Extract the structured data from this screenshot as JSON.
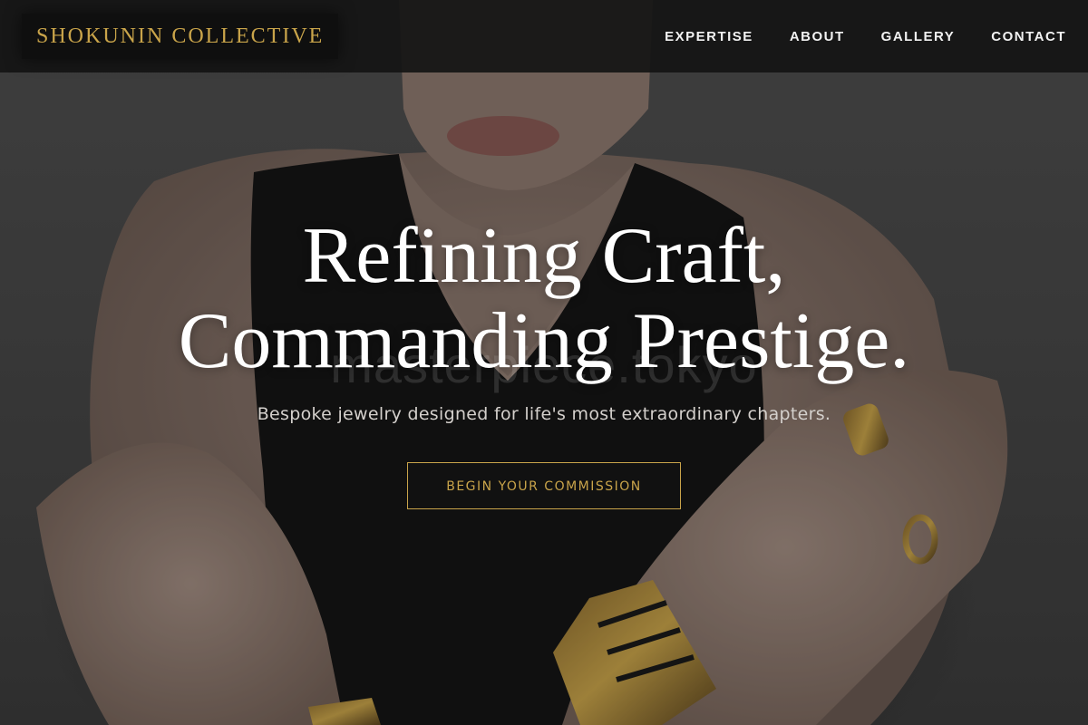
{
  "header": {
    "brand": "SHOKUNIN COLLECTIVE",
    "nav": [
      {
        "label": "EXPERTISE"
      },
      {
        "label": "ABOUT"
      },
      {
        "label": "GALLERY"
      },
      {
        "label": "CONTACT"
      }
    ]
  },
  "hero": {
    "headline_line1": "Refining Craft,",
    "headline_line2": "Commanding Prestige.",
    "subtitle": "Bespoke jewelry designed for life's most extraordinary chapters.",
    "cta_label": "BEGIN YOUR COMMISSION",
    "watermark": "masterpiece.tokyo"
  },
  "colors": {
    "accent_gold": "#c9a44a",
    "nav_background": "#141414",
    "text_white": "#ffffff"
  }
}
